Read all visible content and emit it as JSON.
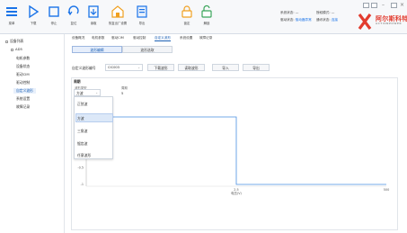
{
  "toolbar": {
    "buttons": [
      {
        "label": "菜单",
        "icon": "menu-icon"
      },
      {
        "label": "下载",
        "icon": "play-icon"
      },
      {
        "label": "停止",
        "icon": "stop-icon"
      },
      {
        "label": "复位",
        "icon": "reset-icon"
      },
      {
        "label": "读取",
        "icon": "read-icon"
      },
      {
        "label": "恢复出厂设置",
        "icon": "factory-icon"
      },
      {
        "label": "导出",
        "icon": "export-icon"
      },
      {
        "label": "锁定",
        "icon": "lock-icon"
      },
      {
        "label": "解锁",
        "icon": "unlock-icon"
      }
    ],
    "status": {
      "line1_label": "系统状态:",
      "line1_value": "—",
      "line1b_label": "授权模式:",
      "line1b_value": "—",
      "line2_label": "驱动状态:",
      "line2_value": "驱动器异常",
      "line2b_label": "通讯状态:",
      "line2b_value": "连接"
    },
    "logo_text": "阿尔斯科特",
    "logo_sub": "ACTIONPOWER",
    "accent_color": "#e23b2e"
  },
  "sidebar": {
    "items": [
      {
        "label": "设备列表"
      },
      {
        "label": "AD5"
      },
      {
        "label": "电机参数"
      },
      {
        "label": "设备状态"
      },
      {
        "label": "驱动CIM"
      },
      {
        "label": "驱动控制"
      },
      {
        "label": "自定义波形"
      },
      {
        "label": "系统设置"
      },
      {
        "label": "故障记录"
      }
    ]
  },
  "tabs": [
    {
      "label": "设备概况"
    },
    {
      "label": "电机参数"
    },
    {
      "label": "驱动CIM"
    },
    {
      "label": "驱动控制"
    },
    {
      "label": "自定义波形"
    },
    {
      "label": "系统设置"
    },
    {
      "label": "故障记录"
    }
  ],
  "subtabs": [
    {
      "label": "波形编辑"
    },
    {
      "label": "波形选取"
    }
  ],
  "controls": {
    "label": "自定义波形编号",
    "select_value": "CIC003",
    "buttons": [
      "下载波形",
      "读取波形",
      "导入",
      "导出"
    ]
  },
  "panel": {
    "title": "周期",
    "field1_label": "波形类型",
    "field2_label": "周期",
    "combo_value": "方波",
    "field2_value": "5",
    "dropdown_items": [
      "正弦波",
      "方波",
      "三角波",
      "锯齿波",
      "任意波形"
    ]
  },
  "chart_data": {
    "type": "line",
    "y_ticks": [
      "0.5",
      "-0.5",
      "-1"
    ],
    "x_ticks": [
      "2.5",
      "500"
    ],
    "xlabel": "电压(V)",
    "ylabel": "电流",
    "series": [
      {
        "x": [
          0,
          250,
          250,
          500
        ],
        "y": [
          1,
          1,
          -1,
          -1
        ],
        "color": "#4a90e2"
      }
    ]
  }
}
